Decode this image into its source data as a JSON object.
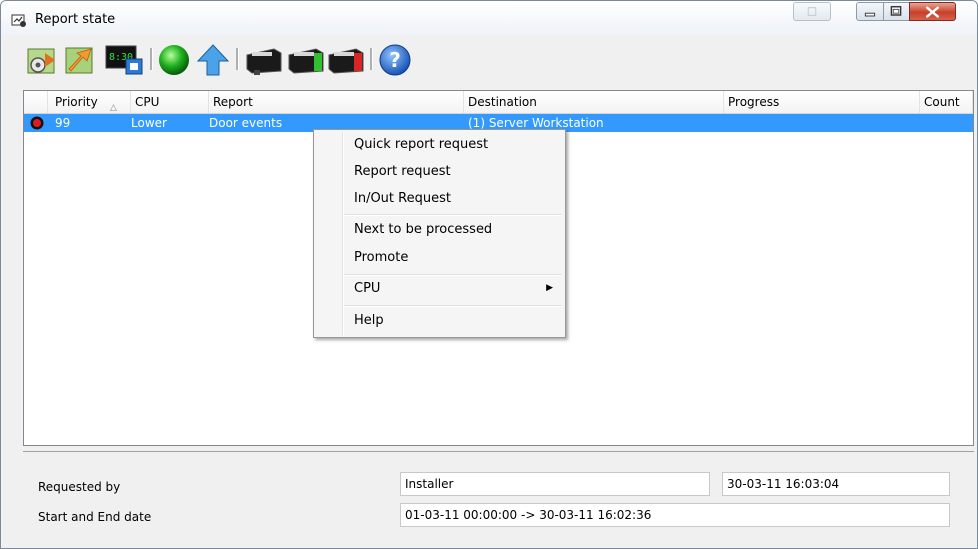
{
  "window": {
    "title": "Report state",
    "controls": {
      "minimize": "minimize",
      "maximize": "maximize",
      "close": "x"
    }
  },
  "toolbar": {
    "icons": [
      "report-settings-icon",
      "export-arrow-icon",
      "clock-monitor-icon",
      "green-status-icon",
      "promote-up-arrow-icon",
      "printer-icon",
      "cpu-green-icon",
      "cpu-red-icon",
      "help-icon"
    ]
  },
  "list": {
    "columns": [
      "Priority",
      "CPU",
      "Report",
      "Destination",
      "Progress",
      "Count"
    ],
    "sort_indicator": "△",
    "rows": [
      {
        "priority": "99",
        "cpu": "Lower",
        "report": "Door events",
        "destination": "(1) Server Workstation",
        "progress": "",
        "count": ""
      }
    ]
  },
  "context_menu": {
    "items": [
      "Quick report request",
      "Report request",
      "In/Out Request",
      "Next to be processed",
      "Promote",
      "CPU",
      "Help"
    ]
  },
  "footer": {
    "requested_by_label": "Requested by",
    "requested_by_value": "Installer",
    "requested_time": "30-03-11 16:03:04",
    "start_end_label": "Start and End date",
    "start_end_value": "01-03-11 00:00:00 -> 30-03-11 16:02:36"
  },
  "colors": {
    "selection": "#3399ff",
    "close_button": "#c7402b",
    "window_bg": "#f0f0f0"
  }
}
